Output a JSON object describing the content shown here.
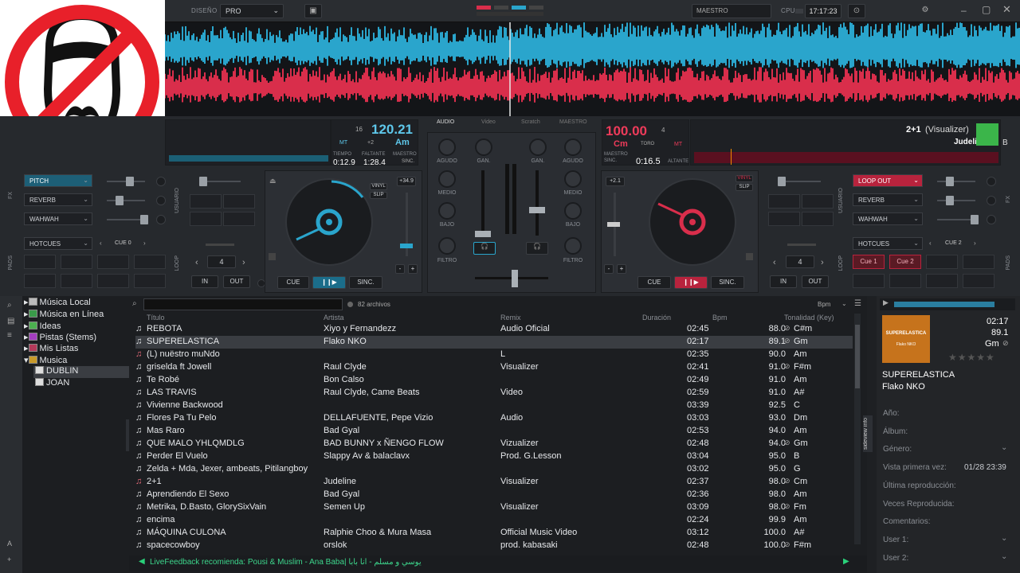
{
  "topbar": {
    "layout_label": "DISEÑO",
    "layout_value": "PRO",
    "master_label": "MAESTRO",
    "cpu_label": "CPU",
    "clock": "17:17:23"
  },
  "colors": {
    "deck_a": "#2aa5cc",
    "deck_b": "#d92e4b",
    "selected_row": "#3a3d42"
  },
  "deck_a": {
    "bpm": "120.21",
    "key": "Am",
    "key_offset": "+2",
    "mt": "MT",
    "beats": "16",
    "time_label": "TIEMPO",
    "time": "0:12.9",
    "remaining_label": "FALTANTE",
    "remaining": "1:28.4",
    "master_label": "MAESTRO",
    "sync_label": "SINC.",
    "pitch_value": "+34.9",
    "vinyl": "VINYL",
    "slip": "SLIP",
    "fx1": "PITCH",
    "fx2": "REVERB",
    "fx3": "WAHWAH",
    "pads_mode": "HOTCUES",
    "cue_sel": "CUE 0",
    "loop_size": "4",
    "in_label": "IN",
    "out_label": "OUT",
    "cue_btn": "CUE",
    "sync_btn": "SINC.",
    "user_label": "USUARIO",
    "fx_label": "FX",
    "pads_label": "PADS",
    "loop_label": "LOOP"
  },
  "deck_b": {
    "bpm": "100.00",
    "key": "Cm",
    "beats": "4",
    "toro": "TORO",
    "mt": "MT",
    "master_label": "MAESTRO",
    "sync_label": "SINC.",
    "time": "0:16.5",
    "remaining_label": "ALTANTE",
    "title": "2+1",
    "remix": "(Visualizer)",
    "artist": "Judeline",
    "deck_letter": "B",
    "pitch_value": "+2.1",
    "vinyl": "VINYL",
    "slip": "SLIP",
    "fx1": "LOOP OUT",
    "fx2": "REVERB",
    "fx3": "WAHWAH",
    "pads_mode": "HOTCUES",
    "cue_sel": "CUE 2",
    "cue1": "Cue 1",
    "cue2": "Cue 2",
    "loop_size": "4",
    "in_label": "IN",
    "out_label": "OUT",
    "cue_btn": "CUE",
    "sync_btn": "SINC.",
    "user_label": "USUARIO",
    "fx_label": "FX",
    "pads_label": "PADS",
    "loop_label": "LOOP"
  },
  "mixer": {
    "tabs": [
      "AUDIO",
      "Video",
      "Scratch",
      "MAESTRO"
    ],
    "gain": "GAN.",
    "high": "AGUDO",
    "mid": "MEDIO",
    "low": "BAJO",
    "filter": "FILTRO"
  },
  "browser": {
    "file_count": "82 archivos",
    "sort_label": "Bpm",
    "columns": [
      "Título",
      "Artista",
      "Remix",
      "Duración",
      "Bpm",
      "Tonalidad (Key)"
    ],
    "tree": [
      "Música Local",
      "Música en Línea",
      "Ideas",
      "Pistas (Stems)",
      "Mis Listas",
      "Musica",
      "DUBLIN",
      "JOAN"
    ],
    "folders_tab": "folders",
    "sideview_tab": "sideview info",
    "rows": [
      {
        "t": "REBOTA",
        "a": "Xiyo y Fernandezz",
        "r": "Audio Oficial",
        "d": "02:45",
        "b": "88.0",
        "k": "C#m",
        "lock": true
      },
      {
        "t": "SUPERELASTICA",
        "a": "Flako NKO",
        "r": "",
        "d": "02:17",
        "b": "89.1",
        "k": "Gm",
        "lock": true
      },
      {
        "t": "(L) nuëstro muNdo",
        "a": "",
        "r": "L",
        "d": "02:35",
        "b": "90.0",
        "k": "Am",
        "lock": false
      },
      {
        "t": "griselda ft Jowell",
        "a": "Raul Clyde",
        "r": "Visualizer",
        "d": "02:41",
        "b": "91.0",
        "k": "F#m",
        "lock": true
      },
      {
        "t": "Te Robé",
        "a": "Bon Calso",
        "r": "",
        "d": "02:49",
        "b": "91.0",
        "k": "Am",
        "lock": false
      },
      {
        "t": "LAS TRAVIS",
        "a": "Raul Clyde, Came Beats",
        "r": "Video",
        "d": "02:59",
        "b": "91.0",
        "k": "A#",
        "lock": false
      },
      {
        "t": "Vivienne Backwood",
        "a": "",
        "r": "",
        "d": "03:39",
        "b": "92.5",
        "k": "C",
        "lock": false
      },
      {
        "t": "Flores Pa Tu Pelo",
        "a": "DELLAFUENTE, Pepe   Vizio",
        "r": "Audio",
        "d": "03:03",
        "b": "93.0",
        "k": "Dm",
        "lock": false
      },
      {
        "t": "Mas Raro",
        "a": "Bad Gyal",
        "r": "",
        "d": "02:53",
        "b": "94.0",
        "k": "Am",
        "lock": false
      },
      {
        "t": "QUE MALO   YHLQMDLG",
        "a": "BAD BUNNY x ÑENGO FLOW",
        "r": "Vizualizer",
        "d": "02:48",
        "b": "94.0",
        "k": "Gm",
        "lock": true
      },
      {
        "t": "Perder El Vuelo",
        "a": "Slappy Av & balaclavx",
        "r": "Prod. G.Lesson",
        "d": "03:04",
        "b": "95.0",
        "k": "B",
        "lock": false
      },
      {
        "t": "Zelda + Mda, Jexer, ambeats, Pitilangboy",
        "a": "",
        "r": "",
        "d": "03:02",
        "b": "95.0",
        "k": "G",
        "lock": false
      },
      {
        "t": "2+1",
        "a": "Judeline",
        "r": "Visualizer",
        "d": "02:37",
        "b": "98.0",
        "k": "Cm",
        "lock": true
      },
      {
        "t": "Aprendiendo El Sexo",
        "a": "Bad Gyal",
        "r": "",
        "d": "02:36",
        "b": "98.0",
        "k": "Am",
        "lock": false
      },
      {
        "t": "Metrika, D.Basto, GlorySixVain",
        "a": "Semen Up",
        "r": "Visualizer",
        "d": "03:09",
        "b": "98.0",
        "k": "Fm",
        "lock": true
      },
      {
        "t": "encima",
        "a": "",
        "r": "",
        "d": "02:24",
        "b": "99.9",
        "k": "Am",
        "lock": false
      },
      {
        "t": "MÁQUINA CULONA",
        "a": "Ralphie Choo & Mura Masa",
        "r": "Official Music Video",
        "d": "03:12",
        "b": "100.0",
        "k": "A#",
        "lock": false
      },
      {
        "t": "spacecowboy",
        "a": "orslok",
        "r": "prod. kabasaki",
        "d": "02:48",
        "b": "100.0",
        "k": "F#m",
        "lock": true
      }
    ],
    "livefeedback": "LiveFeedback recomienda: Pousi & Muslim - Ana Baba| يوسي و مسلم - انا بابا"
  },
  "sideinfo": {
    "cover_title": "SUPERELASTICA",
    "cover_sub": "Flako NKO",
    "duration": "02:17",
    "bpm": "89.1",
    "key": "Gm",
    "title": "SUPERELASTICA",
    "artist": "Flako NKO",
    "rating": 0,
    "fields": [
      {
        "label": "Año:",
        "value": ""
      },
      {
        "label": "Álbum:",
        "value": ""
      },
      {
        "label": "Género:",
        "value": ""
      },
      {
        "label": "Vista primera vez:",
        "value": "01/28 23:39"
      },
      {
        "label": "Última reproducción:",
        "value": ""
      },
      {
        "label": "Veces Reproducida:",
        "value": ""
      },
      {
        "label": "Comentarios:",
        "value": ""
      },
      {
        "label": "User 1:",
        "value": ""
      },
      {
        "label": "User 2:",
        "value": ""
      }
    ]
  }
}
